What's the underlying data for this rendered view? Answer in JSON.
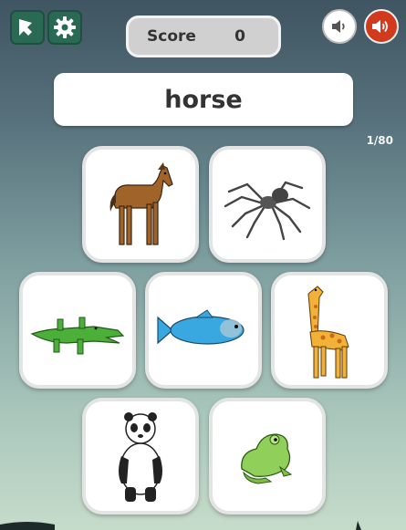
{
  "header": {
    "score_label": "Score",
    "score_value": "0",
    "icons": [
      "exit-icon",
      "gear-icon",
      "speaker-icon",
      "speaker-loud-icon"
    ]
  },
  "prompt": {
    "word": "horse"
  },
  "progress": {
    "text": "1/80"
  },
  "cards": [
    {
      "animal": "horse"
    },
    {
      "animal": "spider"
    },
    {
      "animal": "crocodile"
    },
    {
      "animal": "fish"
    },
    {
      "animal": "giraffe"
    },
    {
      "animal": "panda"
    },
    {
      "animal": "frog"
    }
  ],
  "colors": {
    "accent_green": "#2a6a55",
    "sound_button_red": "#d13a1c",
    "card_border": "#e4e4e4"
  }
}
